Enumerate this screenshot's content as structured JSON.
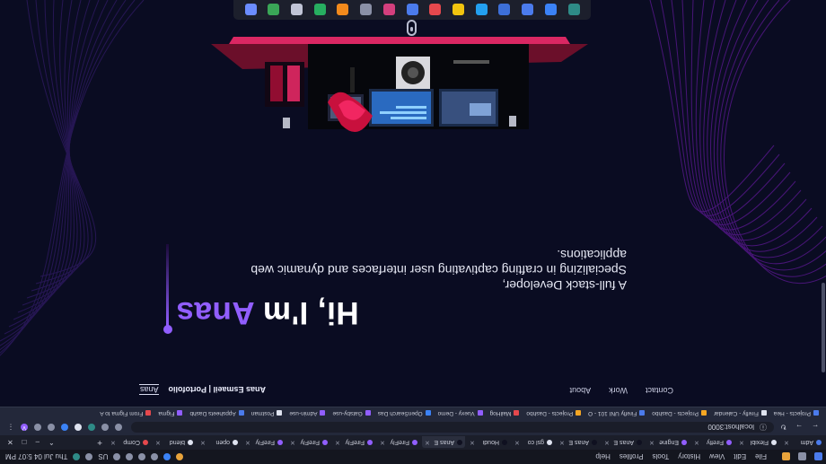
{
  "taskbar": {
    "menu": [
      "File",
      "Edit",
      "View",
      "History",
      "Tools",
      "Profiles",
      "Help"
    ],
    "clock": "Thu Jul 04 5:07 PM",
    "lang": "US"
  },
  "tabs": [
    {
      "label": "Adm",
      "color": "#4b7bec"
    },
    {
      "label": "Flexibl",
      "color": "#dfe3f0"
    },
    {
      "label": "Firefly",
      "color": "#915eff"
    },
    {
      "label": "Engine",
      "color": "#915eff"
    },
    {
      "label": "Anas E",
      "color": "#0f1020"
    },
    {
      "label": "Anas E",
      "color": "#0f1020"
    },
    {
      "label": "gsl co",
      "color": "#dfe3f0"
    },
    {
      "label": "Houdi",
      "color": "#0f1020"
    },
    {
      "label": "Anas E",
      "color": "#0f1020"
    },
    {
      "label": "FireFly",
      "color": "#915eff"
    },
    {
      "label": "FireFly",
      "color": "#915eff"
    },
    {
      "label": "FireFly",
      "color": "#915eff"
    },
    {
      "label": "FireFly",
      "color": "#915eff"
    },
    {
      "label": "open",
      "color": "#dfe3f0"
    },
    {
      "label": "blend",
      "color": "#dfe3f0"
    },
    {
      "label": "Comp",
      "color": "#e5484d"
    }
  ],
  "browser": {
    "url": "localhost:3000",
    "profile_initial": "V"
  },
  "bookmarks": [
    {
      "label": "Projects - Hea",
      "color": "#4b7bec"
    },
    {
      "label": "Firefly - Calendar",
      "color": "#dfe3f0"
    },
    {
      "label": "Projects - Dashbo",
      "color": "#f5a623"
    },
    {
      "label": "Firefly UNI 101 - O",
      "color": "#4b7bec"
    },
    {
      "label": "Projects - Dashbo",
      "color": "#f5a623"
    },
    {
      "label": "MailHog",
      "color": "#e5484d"
    },
    {
      "label": "Vuexy - Demo",
      "color": "#915eff"
    },
    {
      "label": "OpenSearch Das",
      "color": "#3b82f6"
    },
    {
      "label": "Gatsby-use",
      "color": "#915eff"
    },
    {
      "label": "Admin-use",
      "color": "#915eff"
    },
    {
      "label": "Postman",
      "color": "#dfe3f0"
    },
    {
      "label": "Appsheets Dashb",
      "color": "#4b7bec"
    },
    {
      "label": "Figma",
      "color": "#915eff"
    },
    {
      "label": "From Figma to A",
      "color": "#e5484d"
    }
  ],
  "site": {
    "brand_logo": "Anas",
    "brand_name": "Anas Esmaeil | Portofolio",
    "nav": [
      "About",
      "Work",
      "Contact"
    ],
    "hero_prefix": "Hi, I'm ",
    "hero_name": "Anas",
    "hero_sub_1": "A full-stack Developer,",
    "hero_sub_2": "Specializing in crafting captivating user interfaces and dynamic web",
    "hero_sub_3": "applications.",
    "accent": "#915eff",
    "background": "#0a0c22"
  },
  "dock": [
    {
      "name": "app-icon-1",
      "color": "#2e8b87"
    },
    {
      "name": "app-icon-2",
      "color": "#3b82f6"
    },
    {
      "name": "app-icon-3",
      "color": "#4b7bec"
    },
    {
      "name": "app-icon-4",
      "color": "#3d6fd8"
    },
    {
      "name": "vscode-icon",
      "color": "#23a0f0"
    },
    {
      "name": "chrome-icon",
      "color": "#f1c40f"
    },
    {
      "name": "slack-icon",
      "color": "#e5484d"
    },
    {
      "name": "app-icon-8",
      "color": "#4b7bec"
    },
    {
      "name": "app-icon-9",
      "color": "#d33f7d"
    },
    {
      "name": "app-icon-10",
      "color": "#8a90a6"
    },
    {
      "name": "app-icon-11",
      "color": "#f28a1c"
    },
    {
      "name": "app-icon-12",
      "color": "#27ae60"
    },
    {
      "name": "app-icon-13",
      "color": "#c0c4d6"
    },
    {
      "name": "app-icon-14",
      "color": "#3aa657"
    },
    {
      "name": "app-icon-15",
      "color": "#6b8cff"
    }
  ]
}
